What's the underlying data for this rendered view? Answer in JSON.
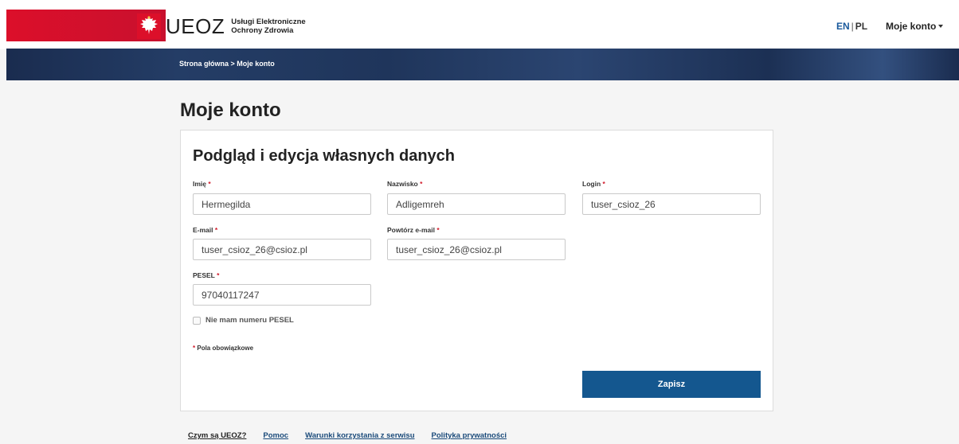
{
  "header": {
    "logo_text": "UEOZ",
    "logo_sub_line1": "Usługi Elektroniczne",
    "logo_sub_line2": "Ochrony Zdrowia",
    "lang_en": "EN",
    "lang_sep": "|",
    "lang_pl": "PL",
    "account_menu": "Moje konto"
  },
  "breadcrumb": "Strona główna > Moje konto",
  "page_title": "Moje konto",
  "card": {
    "title": "Podgląd i edycja własnych danych",
    "fields": {
      "first_name": {
        "label": "Imię",
        "value": "Hermegilda"
      },
      "last_name": {
        "label": "Nazwisko",
        "value": "Adligemreh"
      },
      "login": {
        "label": "Login",
        "value": "tuser_csioz_26"
      },
      "email": {
        "label": "E-mail",
        "value": "tuser_csioz_26@csioz.pl"
      },
      "email_repeat": {
        "label": "Powtórz e-mail",
        "value": "tuser_csioz_26@csioz.pl"
      },
      "pesel": {
        "label": "PESEL",
        "value": "97040117247"
      }
    },
    "required_mark": "*",
    "no_pesel_label": "Nie mam numeru PESEL",
    "required_note": "Pola obowiązkowe",
    "save_label": "Zapisz"
  },
  "footer": {
    "links": [
      "Czym są UEOZ?",
      "Pomoc",
      "Warunki korzystania z serwisu",
      "Polityka prywatności"
    ]
  },
  "colors": {
    "brand_red": "#dc0f2a",
    "band_navy": "#1a2c4f",
    "button_blue": "#14578f",
    "lang_active": "#1a5a9c",
    "required_red": "#d11a2a"
  },
  "icons": {
    "logo": "polish-eagle-icon",
    "menu_caret": "caret-down-icon",
    "checkbox": "checkbox-unchecked"
  }
}
